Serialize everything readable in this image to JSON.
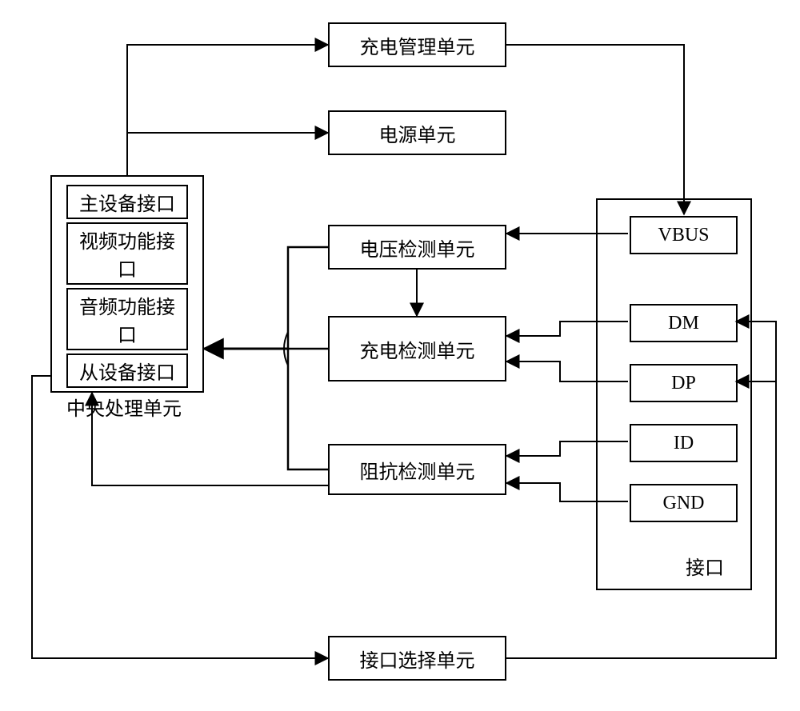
{
  "chart_data": {
    "type": "diagram",
    "title": "",
    "xlabel": "",
    "ylabel": "",
    "cpu": {
      "label": "中央处理单元",
      "ports": [
        "主设备接口",
        "视频功能接口",
        "音频功能接口",
        "从设备接口"
      ]
    },
    "interface": {
      "label": "接口",
      "pins": [
        "VBUS",
        "DM",
        "DP",
        "ID",
        "GND"
      ]
    },
    "units": {
      "charge_mgmt": "充电管理单元",
      "power": "电源单元",
      "voltage_detect": "电压检测单元",
      "charge_detect": "充电检测单元",
      "impedance_detect": "阻抗检测单元",
      "iface_select": "接口选择单元"
    },
    "edges": [
      [
        "中央处理单元",
        "充电管理单元"
      ],
      [
        "中央处理单元",
        "电源单元"
      ],
      [
        "充电管理单元",
        "VBUS"
      ],
      [
        "VBUS",
        "电压检测单元"
      ],
      [
        "电压检测单元",
        "中央处理单元"
      ],
      [
        "电压检测单元",
        "充电检测单元"
      ],
      [
        "DM",
        "充电检测单元"
      ],
      [
        "DP",
        "充电检测单元"
      ],
      [
        "充电检测单元",
        "中央处理单元"
      ],
      [
        "ID",
        "阻抗检测单元"
      ],
      [
        "GND",
        "阻抗检测单元"
      ],
      [
        "阻抗检测单元",
        "中央处理单元"
      ],
      [
        "中央处理单元",
        "接口选择单元"
      ],
      [
        "接口选择单元",
        "DM"
      ],
      [
        "接口选择单元",
        "DP"
      ]
    ]
  }
}
